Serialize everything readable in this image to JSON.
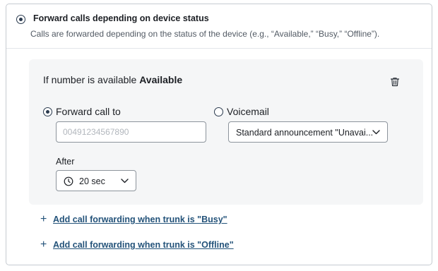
{
  "header": {
    "title": "Forward calls depending on device status",
    "description": "Calls are forwarded depending on the status of the device (e.g., “Available,” “Busy,” “Offline”).",
    "selected": true
  },
  "rule": {
    "title_prefix": "If number is available",
    "title_status": "Available",
    "options": {
      "forward_label": "Forward call to",
      "forward_selected": true,
      "voicemail_label": "Voicemail",
      "voicemail_selected": false
    },
    "number_input": {
      "value": "",
      "placeholder": "00491234567890"
    },
    "announcement_select": {
      "value": "Standard announcement \"Unavai..."
    },
    "after": {
      "label": "After",
      "value": "20 sec"
    },
    "icons": {
      "delete": "trash-icon",
      "clock": "clock-icon",
      "chevron": "chevron-down-icon"
    }
  },
  "add_links": {
    "busy": "Add call forwarding when trunk is \"Busy\"",
    "offline": "Add call forwarding when trunk is \"Offline\"",
    "icon": "plus-icon"
  },
  "colors": {
    "accent": "#2a3a4e",
    "link": "#24537a",
    "panel_bg": "#f5f6f7",
    "border": "#c6cbd1"
  }
}
